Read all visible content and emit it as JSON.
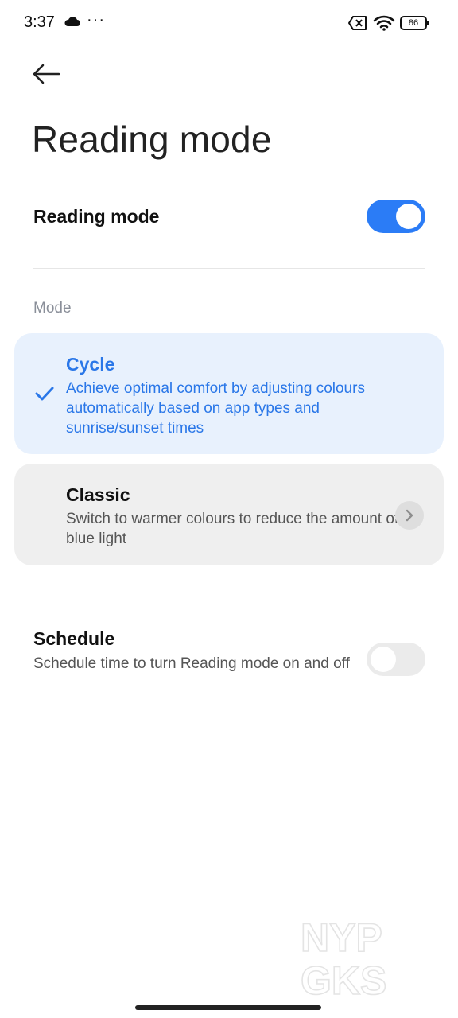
{
  "status_bar": {
    "time": "3:37",
    "battery": "86",
    "notification_dots": "···"
  },
  "header": {
    "back_icon": "arrow-left-icon",
    "title": "Reading mode"
  },
  "reading_mode": {
    "label": "Reading mode",
    "enabled": true
  },
  "mode_section": {
    "label": "Mode",
    "options": [
      {
        "title": "Cycle",
        "description": "Achieve optimal comfort by adjusting colours automatically based on app types and sunrise/sunset times",
        "selected": true
      },
      {
        "title": "Classic",
        "description": "Switch to warmer colours to reduce the amount of blue light",
        "selected": false
      }
    ]
  },
  "schedule": {
    "title": "Schedule",
    "description": "Schedule time to turn Reading mode on and off",
    "enabled": false
  },
  "watermark": {
    "line1": "NYP",
    "line2": "GKS"
  },
  "colors": {
    "accent": "#2b7cf6",
    "accent_text": "#2a77e8",
    "selected_card_bg": "#e8f1fd",
    "card_bg": "#efefef"
  }
}
